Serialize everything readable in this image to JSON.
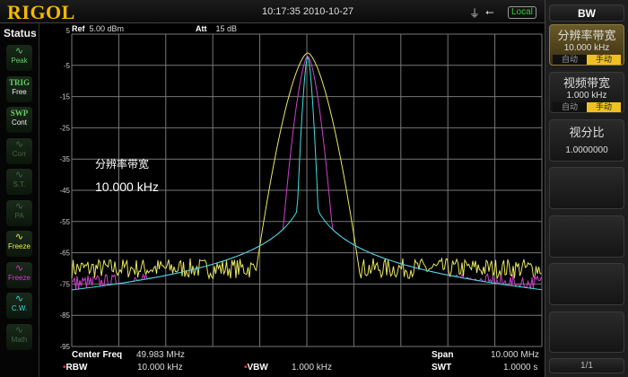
{
  "header": {
    "logo": "RIGOL",
    "datetime": "10:17:35 2010-10-27",
    "remote_status": "Local"
  },
  "status_panel": {
    "title": "Status",
    "buttons": [
      {
        "top": "",
        "label": "Peak",
        "color": "#6c6",
        "dim": false
      },
      {
        "top": "TRIG",
        "label": "Free",
        "color": "#6c6",
        "dim": false
      },
      {
        "top": "SWP",
        "label": "Cont",
        "color": "#6c6",
        "dim": false
      },
      {
        "top": "",
        "label": "Corr",
        "color": "#464",
        "dim": true
      },
      {
        "top": "",
        "label": "S.T.",
        "color": "#464",
        "dim": true
      },
      {
        "top": "",
        "label": "PA",
        "color": "#464",
        "dim": true
      },
      {
        "top": "",
        "label": "Freeze",
        "color": "#ee4",
        "dim": false
      },
      {
        "top": "",
        "label": "Freeze",
        "color": "#d3d",
        "dim": false
      },
      {
        "top": "",
        "label": "C.W.",
        "color": "#3dd",
        "dim": false
      },
      {
        "top": "",
        "label": "Math",
        "color": "#464",
        "dim": true
      }
    ]
  },
  "display": {
    "ref_label": "Ref",
    "ref_value": "5.00 dBm",
    "att_label": "Att",
    "att_value": "15 dB",
    "y_ticks": [
      "5",
      "-5",
      "-15",
      "-25",
      "-35",
      "-45",
      "-55",
      "-65",
      "-75",
      "-85",
      "-95"
    ],
    "overlay_title": "分辨率带宽",
    "overlay_value": "10.000 kHz"
  },
  "traces": [
    {
      "name": "trace-yellow",
      "color": "#e8e860",
      "floor_dbm": -70,
      "noise_db": 2,
      "peak_dbm": -1,
      "width": 1.0
    },
    {
      "name": "trace-magenta",
      "color": "#d040d0",
      "floor_dbm": -75,
      "noise_db": 2,
      "peak_dbm": -2,
      "width": 0.55
    },
    {
      "name": "trace-cyan",
      "color": "#40e0e0",
      "floor_dbm": -84,
      "noise_db": 1.5,
      "peak_dbm": -2,
      "width": 0.25
    }
  ],
  "footer": {
    "center_label": "Center Freq",
    "center_value": "49.983 MHz",
    "span_label": "Span",
    "span_value": "10.000 MHz",
    "rbw_label": "RBW",
    "rbw_value": "10.000 kHz",
    "vbw_label": "VBW",
    "vbw_value": "1.000 kHz",
    "swt_label": "SWT",
    "swt_value": "1.0000 s"
  },
  "menu": {
    "title": "BW",
    "rbw": {
      "label": "分辨率带宽",
      "value": "10.000 kHz",
      "auto": "自动",
      "manual": "手动"
    },
    "vbw": {
      "label": "视频带宽",
      "value": "1.000 kHz",
      "auto": "自动",
      "manual": "手动"
    },
    "ratio": {
      "label": "视分比",
      "value": "1.0000000"
    },
    "page": "1/1"
  }
}
